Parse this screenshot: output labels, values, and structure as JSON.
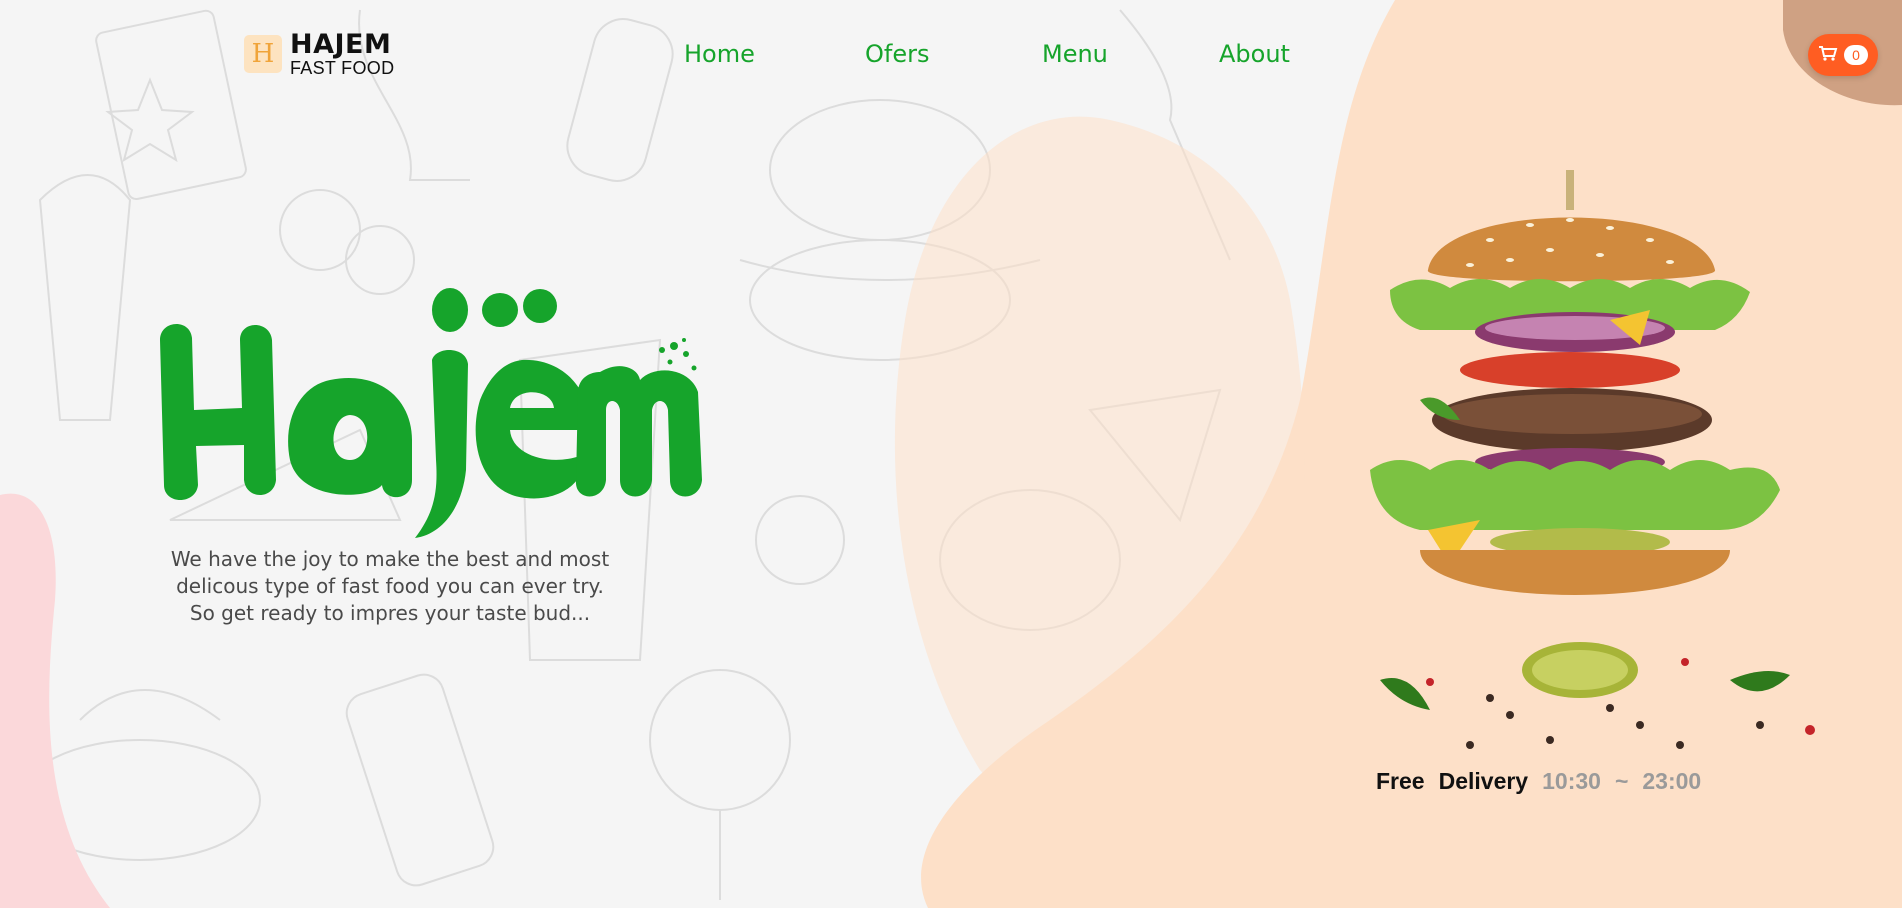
{
  "brand": {
    "mark": "H",
    "name": "HAJEM",
    "sub": "FAST FOOD"
  },
  "nav": {
    "items": [
      {
        "label": "Home"
      },
      {
        "label": "Ofers"
      },
      {
        "label": "Menu"
      },
      {
        "label": "About"
      }
    ]
  },
  "cart": {
    "icon": "cart-icon",
    "count": "0"
  },
  "hero": {
    "wordmark": "Hajëm",
    "tagline": [
      "We have the joy to make the best and most",
      "delicous type of fast food you can ever try.",
      "So get ready to impres your taste bud..."
    ]
  },
  "delivery": {
    "label_1": "Free",
    "label_2": "Delivery",
    "open": "10:30",
    "sep": "~",
    "close": "23:00"
  },
  "colors": {
    "accent_green": "#16a42b",
    "cart_orange": "#ff5d22",
    "peach_blob": "#fde0c8",
    "pink_blob": "#fbd8da",
    "background": "#f5f5f5"
  }
}
